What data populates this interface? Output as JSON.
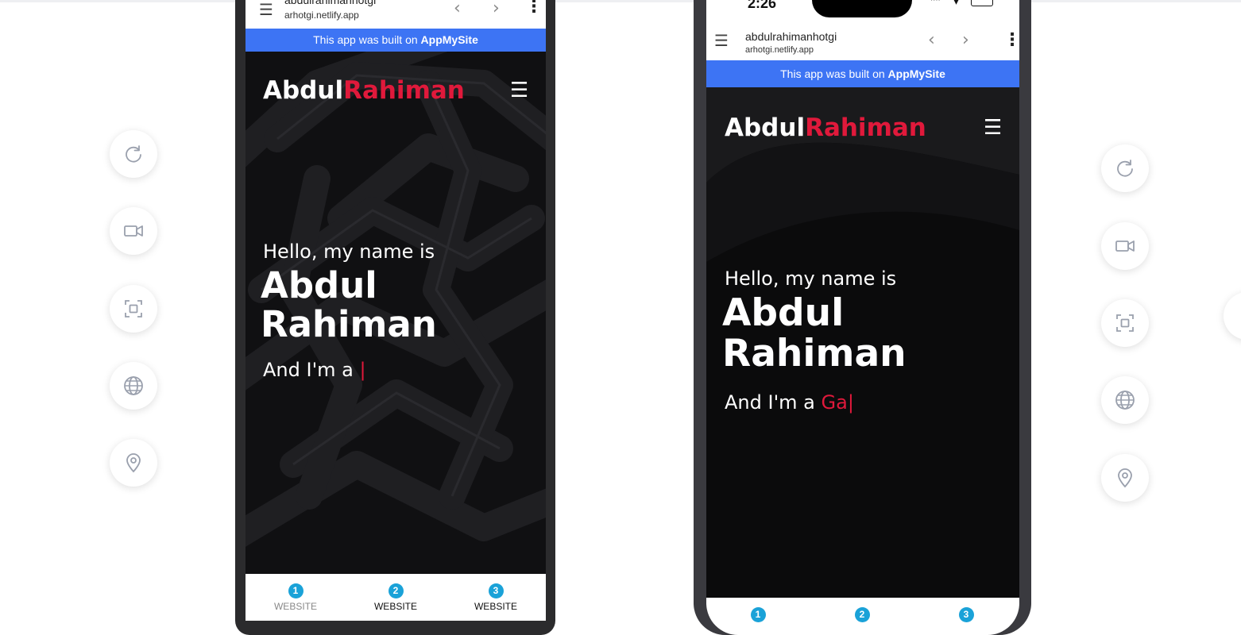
{
  "tools": {
    "icons": [
      "refresh-icon",
      "video-camera-icon",
      "screenshot-icon",
      "globe-icon",
      "location-pin-icon"
    ]
  },
  "device_a": {
    "browser": {
      "site": "abdulrahimanhotgi",
      "url": "arhotgi.netlify.app"
    },
    "banner": {
      "prefix": "This app was built on ",
      "brand": "AppMySite"
    },
    "logo": {
      "first": "Abdul",
      "second": "Rahiman"
    },
    "hero": {
      "greeting": "Hello, my name is",
      "name_line1": "Abdul",
      "name_line2": "Rahiman",
      "role_prefix": "And I'm a ",
      "role_typed": "",
      "caret": "|"
    },
    "tabs": [
      {
        "num": "1",
        "label": "WEBSITE"
      },
      {
        "num": "2",
        "label": "WEBSITE"
      },
      {
        "num": "3",
        "label": "WEBSITE"
      }
    ]
  },
  "device_b": {
    "status_time": "2:26",
    "browser": {
      "site": "abdulrahimanhotgi",
      "url": "arhotgi.netlify.app"
    },
    "banner": {
      "prefix": "This app was built on ",
      "brand": "AppMySite"
    },
    "logo": {
      "first": "Abdul",
      "second": "Rahiman"
    },
    "hero": {
      "greeting": "Hello, my name is",
      "name_line1": "Abdul",
      "name_line2": "Rahiman",
      "role_prefix": "And I'm a ",
      "role_typed": "Ga",
      "caret": "|"
    },
    "tabs": [
      {
        "num": "1"
      },
      {
        "num": "2"
      },
      {
        "num": "3"
      }
    ]
  },
  "colors": {
    "accent_red": "#e0193b",
    "banner_blue": "#3d74f4",
    "tab_badge": "#1aa2d8"
  }
}
